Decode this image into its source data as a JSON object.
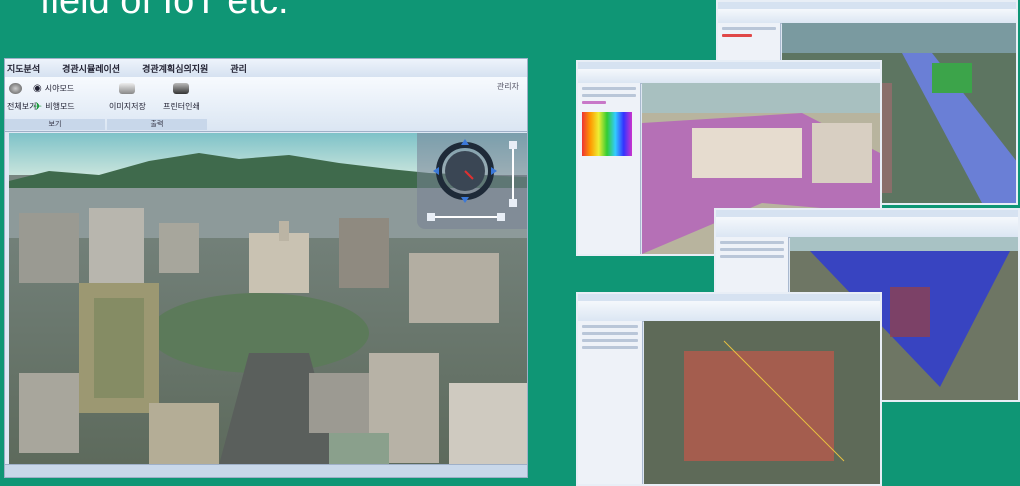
{
  "heading": "field of IoT etc.",
  "main": {
    "menu": [
      "지도분석",
      "경관시뮬레이션",
      "경관계획심의지원",
      "관리"
    ],
    "admin": "관리자",
    "ribbon": {
      "view_all": "전체보기",
      "sight_mode": "시야모드",
      "flight_mode": "비행모드",
      "save_image": "이미지저장",
      "print": "프린터인쇄",
      "group_view": "보기",
      "group_output": "출력"
    }
  },
  "colors": {
    "background": "#0f9675",
    "ribbon": "#dbe6f3"
  }
}
